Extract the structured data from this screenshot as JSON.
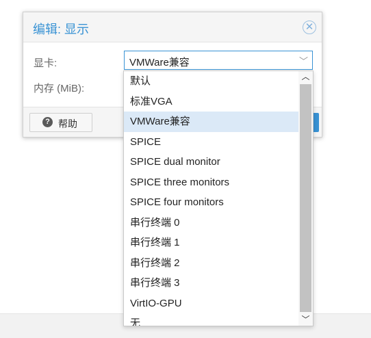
{
  "dialog": {
    "title": "编辑: 显示",
    "close_icon": "close-circle-icon",
    "display_label": "显卡:",
    "memory_label": "内存 (MiB):",
    "display_value": "VMWare兼容",
    "help_label": "帮助",
    "help_icon": "question-circle-icon"
  },
  "dropdown": {
    "options": [
      "默认",
      "标准VGA",
      "VMWare兼容",
      "SPICE",
      "SPICE dual monitor",
      "SPICE three monitors",
      "SPICE four monitors",
      "串行终端 0",
      "串行终端 1",
      "串行终端 2",
      "串行终端 3",
      "VirtIO-GPU",
      "无"
    ],
    "selected": "VMWare兼容"
  },
  "colors": {
    "accent": "#3892d4",
    "selected_row": "#dbe9f7"
  }
}
